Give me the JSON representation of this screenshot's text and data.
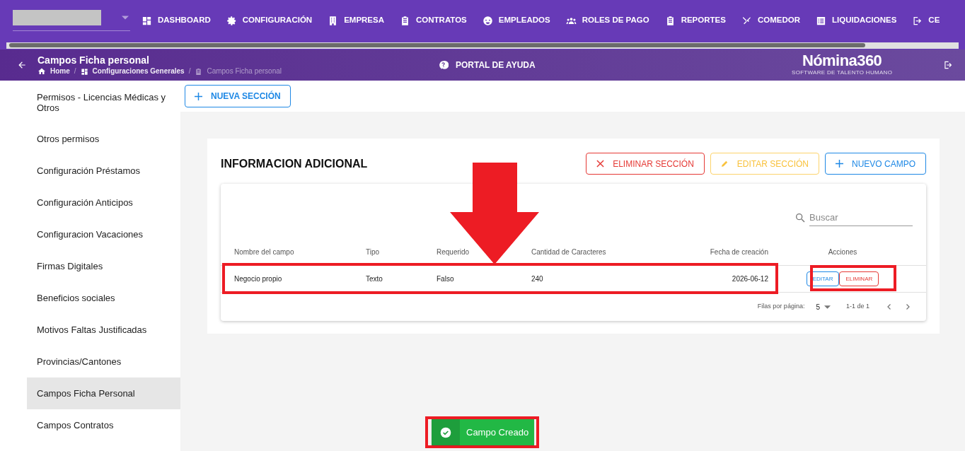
{
  "nav": {
    "items": [
      {
        "label": "DASHBOARD"
      },
      {
        "label": "CONFIGURACIÓN"
      },
      {
        "label": "EMPRESA"
      },
      {
        "label": "CONTRATOS"
      },
      {
        "label": "EMPLEADOS"
      },
      {
        "label": "ROLES DE PAGO"
      },
      {
        "label": "REPORTES"
      },
      {
        "label": "COMEDOR"
      },
      {
        "label": "LIQUIDACIONES"
      },
      {
        "label": "CE"
      }
    ]
  },
  "header": {
    "title": "Campos Ficha personal",
    "breadcrumb": [
      "Home",
      "Configuraciones Generales",
      "Campos Ficha personal"
    ],
    "breadcrumb_separator": "/",
    "help": "PORTAL DE AYUDA",
    "logo": "Nómina360",
    "logo_tagline": "SOFTWARE DE TALENTO HUMANO"
  },
  "sidebar": {
    "items": [
      {
        "label": "Permisos - Licencias Médicas y Otros",
        "selected": false
      },
      {
        "label": "Otros permisos",
        "selected": false
      },
      {
        "label": "Configuración Préstamos",
        "selected": false
      },
      {
        "label": "Configuración Anticipos",
        "selected": false
      },
      {
        "label": "Configuracion Vacaciones",
        "selected": false
      },
      {
        "label": "Firmas Digitales",
        "selected": false
      },
      {
        "label": "Beneficios sociales",
        "selected": false
      },
      {
        "label": "Motivos Faltas Justificadas",
        "selected": false
      },
      {
        "label": "Provincias/Cantones",
        "selected": false
      },
      {
        "label": "Campos Ficha Personal",
        "selected": true
      },
      {
        "label": "Campos Contratos",
        "selected": false
      }
    ]
  },
  "new_section_button": "NUEVA SECCIÓN",
  "section": {
    "title": "INFORMACION ADICIONAL",
    "buttons": [
      {
        "label": "ELIMINAR SECCIÓN",
        "kind": "delete"
      },
      {
        "label": "EDITAR SECCIÓN",
        "kind": "edit"
      },
      {
        "label": "NUEVO CAMPO",
        "kind": "add"
      }
    ],
    "search": {
      "placeholder": "Buscar"
    },
    "table": {
      "columns": [
        "Nombre del campo",
        "Tipo",
        "Requerido",
        "Cantidad de Caracteres",
        "Fecha de creación",
        "Acciones"
      ],
      "rows": [
        {
          "cells": [
            "Negocio propio",
            "Texto",
            "Falso",
            "240",
            "2026-06-12"
          ],
          "actions": [
            "EDITAR",
            "ELIMINAR"
          ]
        }
      ]
    },
    "pagination": {
      "rows_per_page_label": "Filas por página:",
      "rows_per_page": "5",
      "range": "1-1 de 1"
    }
  },
  "toast": {
    "text": "Campo Creado"
  }
}
